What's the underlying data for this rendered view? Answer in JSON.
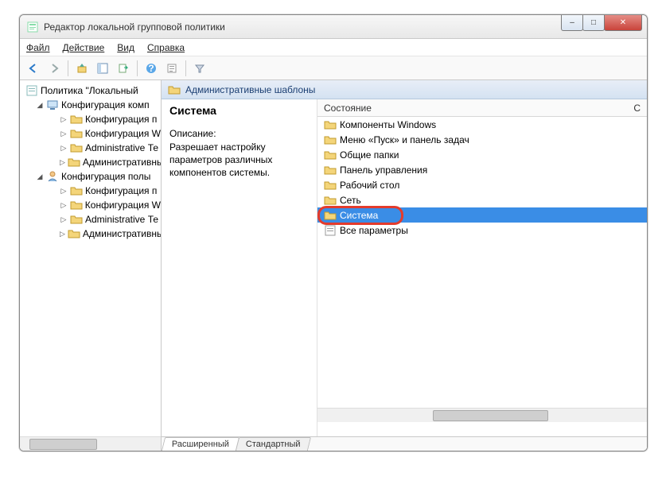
{
  "window": {
    "title": "Редактор локальной групповой политики"
  },
  "menu": {
    "file": "Файл",
    "action": "Действие",
    "view": "Вид",
    "help": "Справка"
  },
  "tree": {
    "root": "Политика \"Локальный",
    "comp_conf": "Конфигурация комп",
    "comp_items": [
      "Конфигурация п",
      "Конфигурация W",
      "Administrative Те",
      "Административные"
    ],
    "user_conf": "Конфигурация полы",
    "user_items": [
      "Конфигурация п",
      "Конфигурация W",
      "Administrative Те",
      "Административные"
    ]
  },
  "content": {
    "path": "Административные шаблоны",
    "details_title": "Система",
    "desc_label": "Описание:",
    "desc": "Разрешает настройку параметров различных компонентов системы.",
    "header_state": "Состояние",
    "header_right": "С",
    "items": [
      "Компоненты Windows",
      "Меню «Пуск» и панель задач",
      "Общие папки",
      "Панель управления",
      "Рабочий стол",
      "Сеть",
      "Система",
      "Все параметры"
    ],
    "selected_index": 6,
    "tabs": {
      "extended": "Расширенный",
      "standard": "Стандартный"
    }
  }
}
